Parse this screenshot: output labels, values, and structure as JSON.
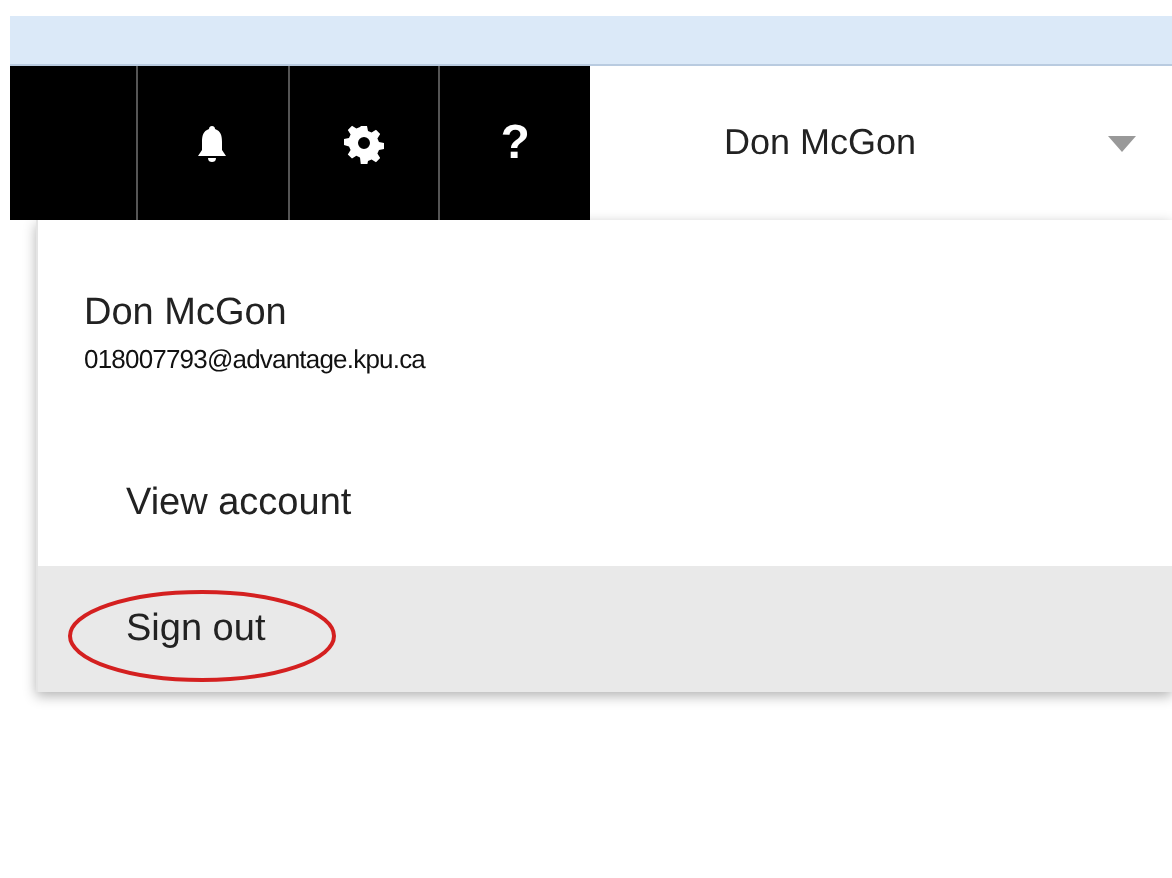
{
  "top_bar": {
    "icons": [
      {
        "kind": "blank"
      },
      {
        "kind": "bell"
      },
      {
        "kind": "gear"
      },
      {
        "kind": "help",
        "label": "?"
      }
    ],
    "user_name": "Don McGon"
  },
  "account_menu": {
    "name": "Don McGon",
    "email": "018007793@advantage.kpu.ca",
    "items": [
      {
        "label": "View account",
        "selected": false,
        "circled": false
      },
      {
        "label": "Sign out",
        "selected": true,
        "circled": true
      }
    ]
  }
}
